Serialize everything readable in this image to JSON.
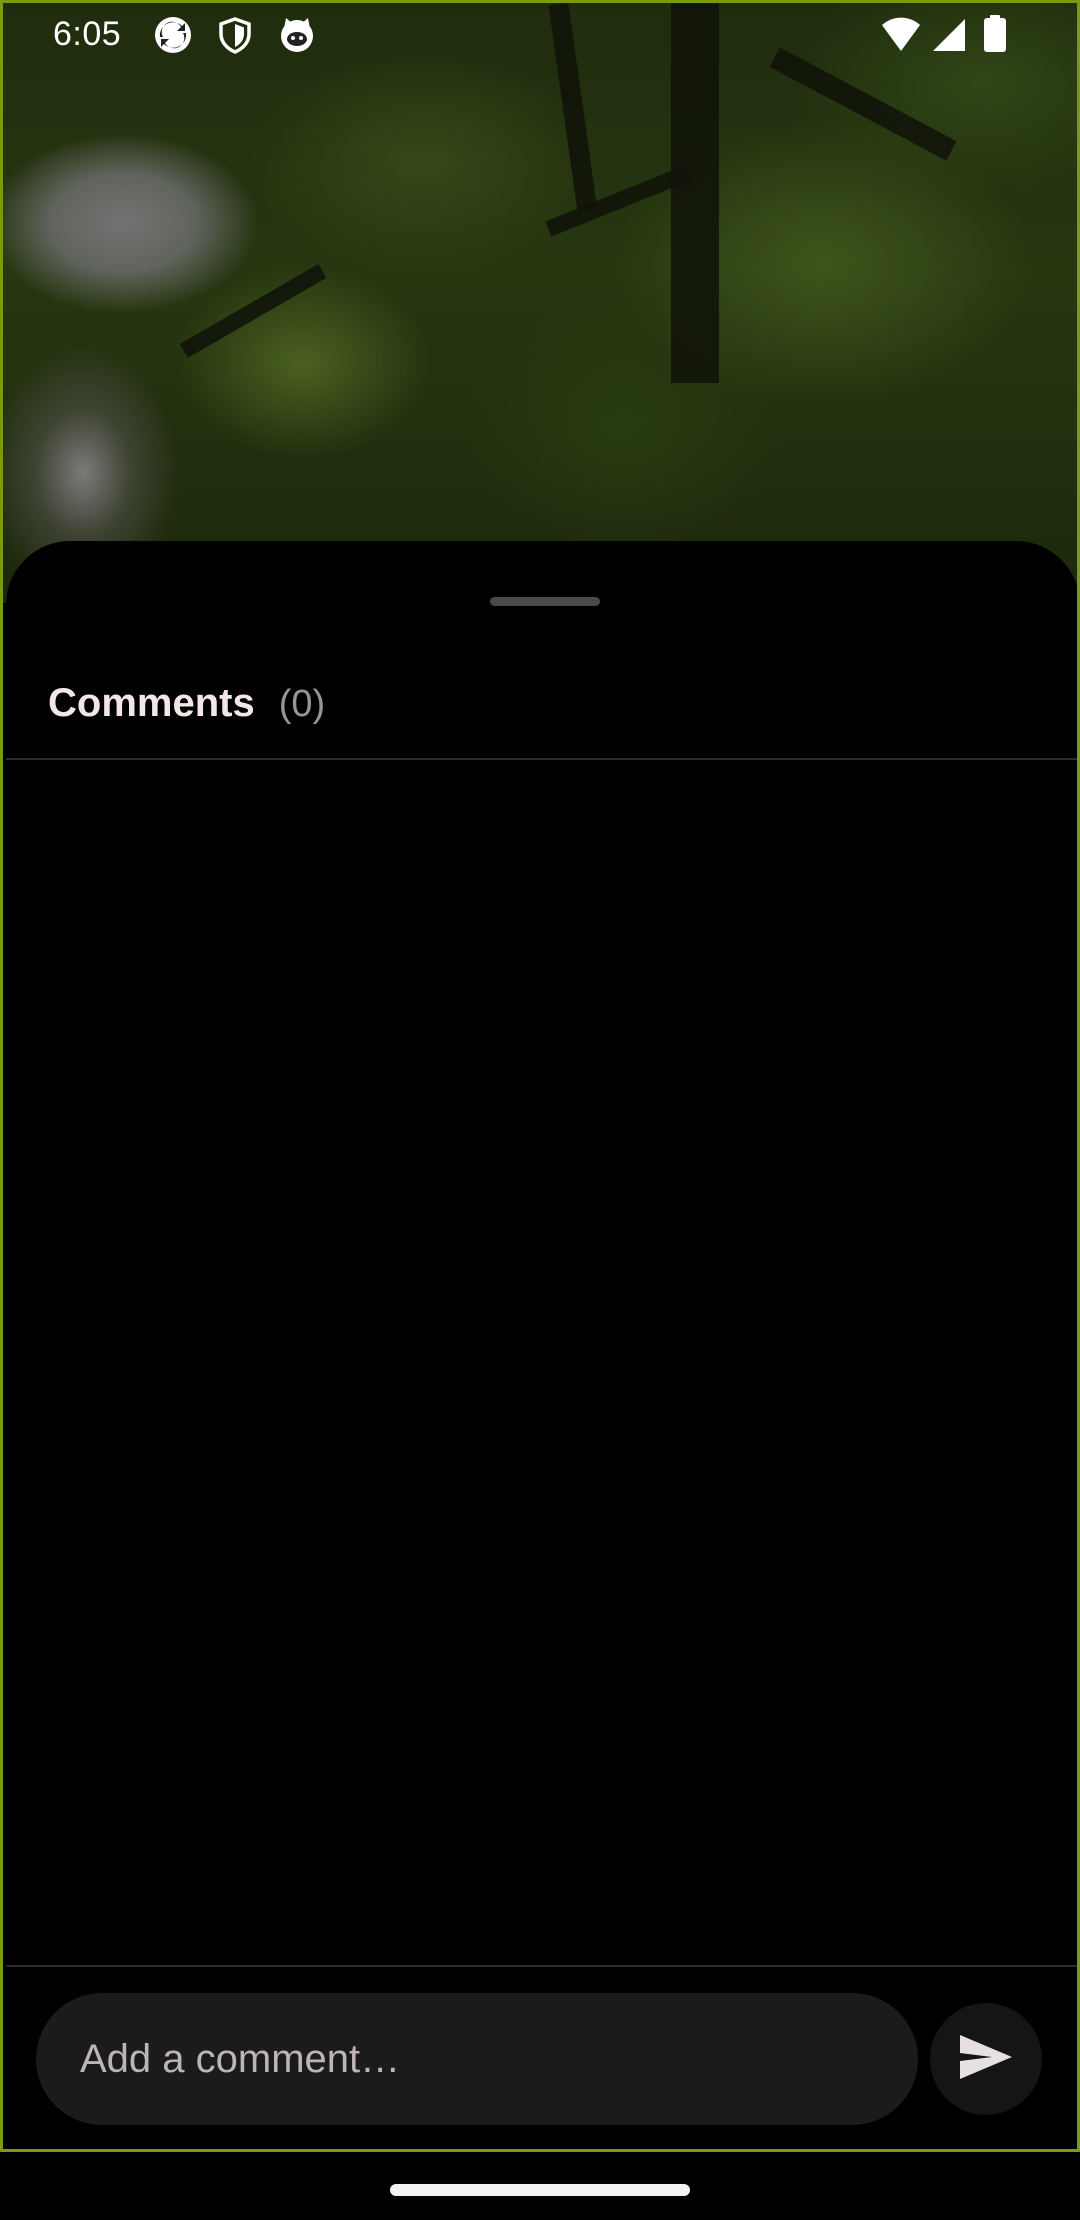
{
  "status_bar": {
    "time": "6:05",
    "left_icons": [
      "sync-app-icon",
      "shield-icon",
      "cat-face-icon"
    ],
    "right_icons": [
      "wifi-icon",
      "signal-icon",
      "battery-icon"
    ]
  },
  "comments_sheet": {
    "title": "Comments",
    "count": "(0)",
    "comments": []
  },
  "composer": {
    "placeholder": "Add a comment…",
    "send_icon": "send-icon"
  },
  "colors": {
    "sheet_background": "#000000",
    "title_text": "#f3e6e6",
    "count_text": "#9a9494",
    "input_background": "#1c1b1b",
    "frame_outline": "#7a9a12"
  }
}
